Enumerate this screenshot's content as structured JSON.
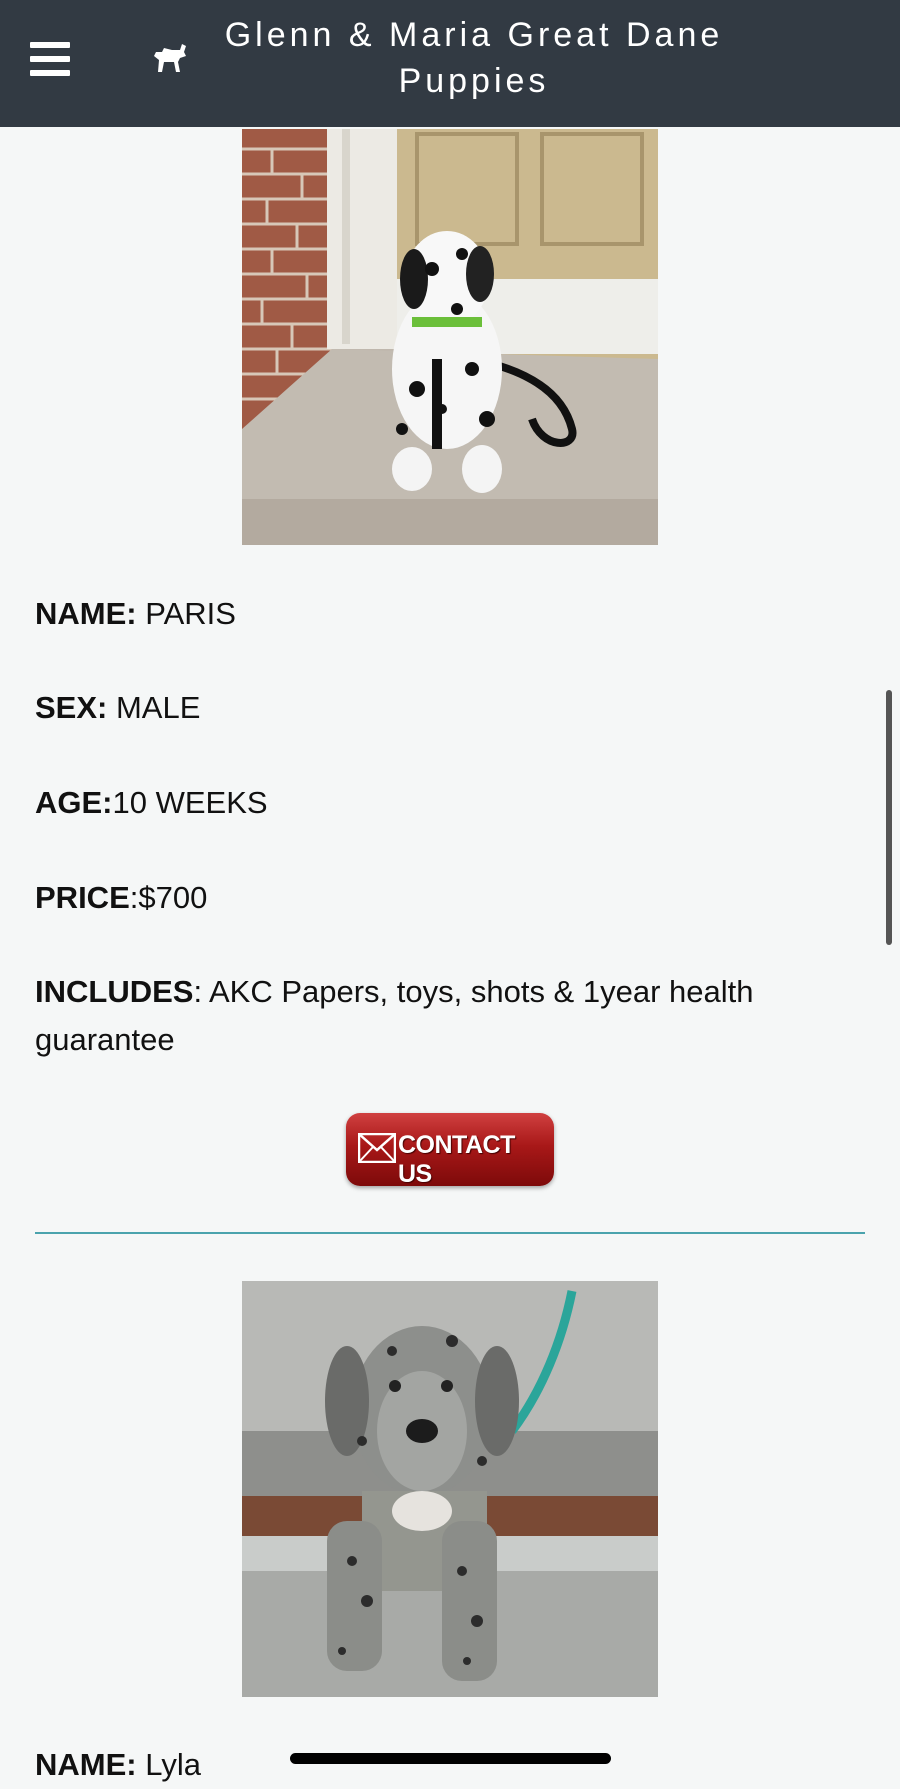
{
  "header": {
    "title": "Glenn & Maria Great Dane Puppies",
    "menu_icon": "hamburger-menu-icon",
    "logo_icon": "dog-icon"
  },
  "puppies": [
    {
      "name_label": "NAME:",
      "name": " PARIS",
      "sex_label": "SEX:",
      "sex": " MALE",
      "age_label": "AGE:",
      "age": "10 WEEKS",
      "price_label": "PRICE",
      "price": ":$700",
      "includes_label": "INCLUDES",
      "includes": ": AKC Papers, toys, shots & 1year health guarantee",
      "contact_label": "CONTACT US"
    },
    {
      "name_label": "NAME:",
      "name": " Lyla"
    }
  ],
  "colors": {
    "header_bg": "#323a43",
    "divider": "#4aa3ad",
    "contact_button": "#a81818"
  }
}
